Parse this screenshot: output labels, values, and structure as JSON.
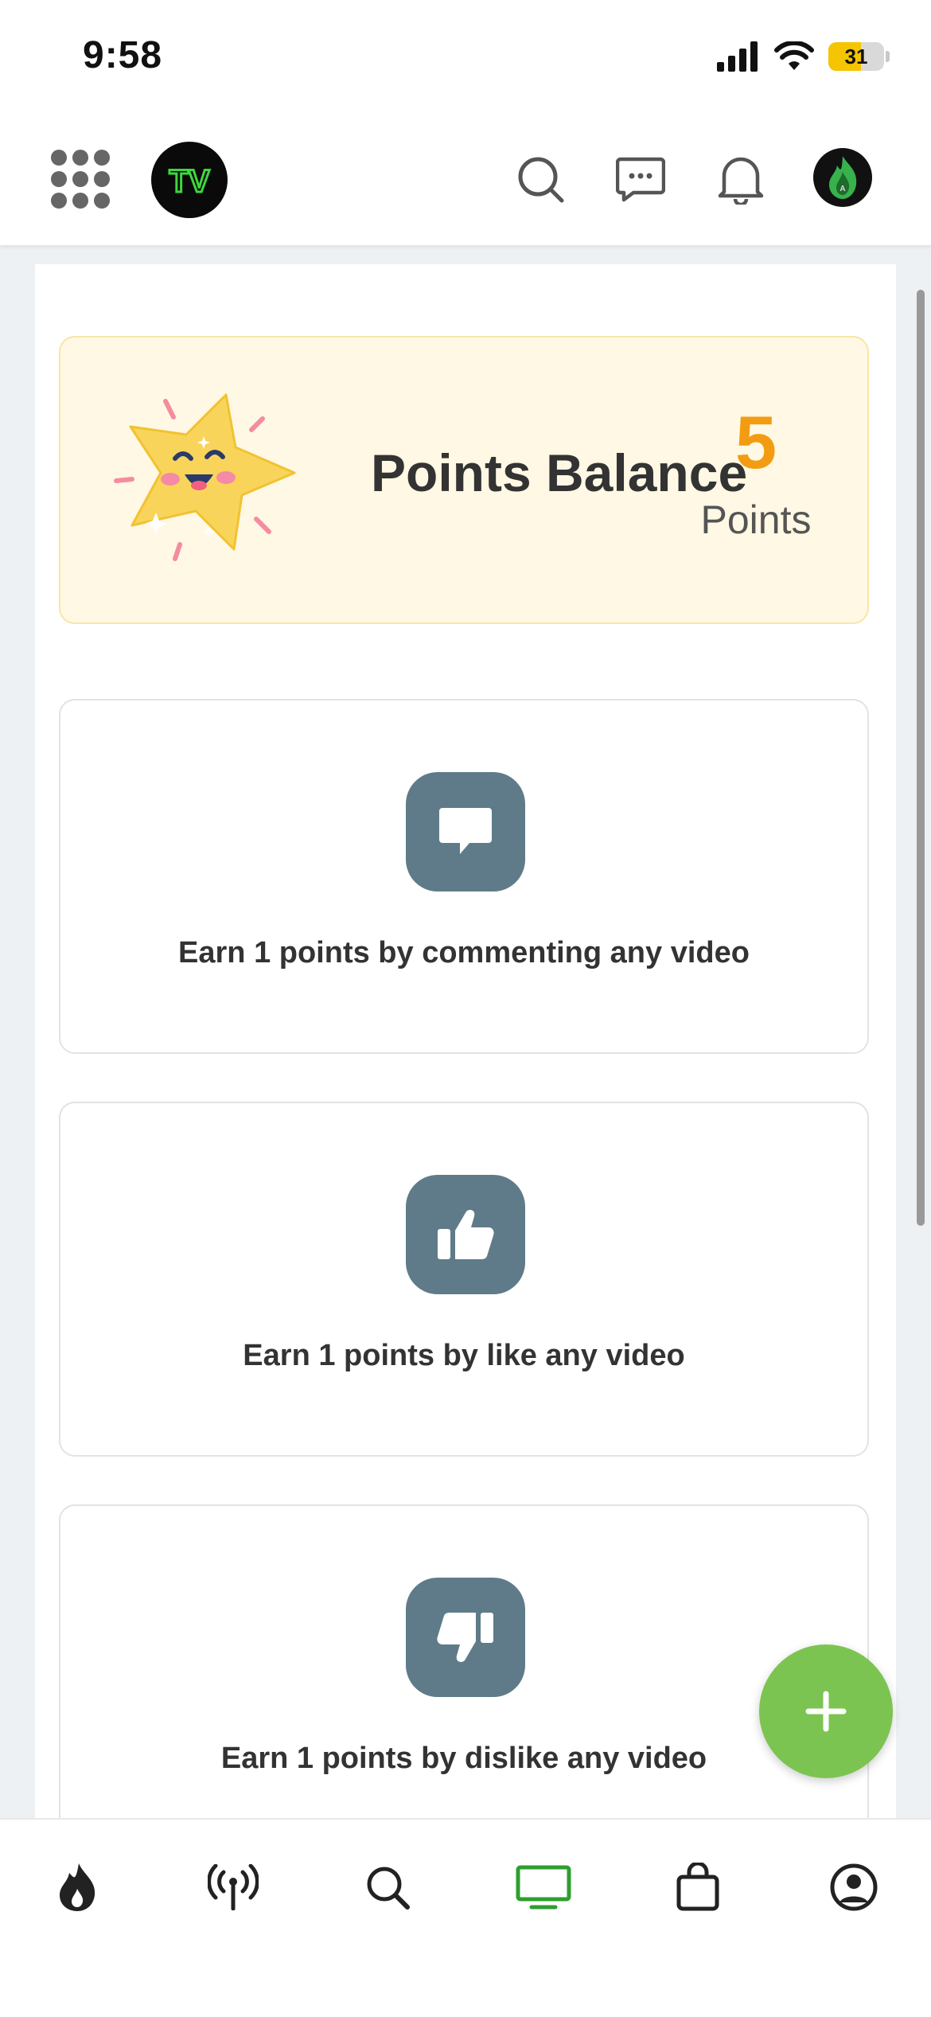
{
  "status_bar": {
    "time": "9:58",
    "battery": "31"
  },
  "header": {
    "logo_text": "TV",
    "icons": [
      "grid-menu-icon",
      "search-icon",
      "chat-icon",
      "bell-icon",
      "avatar"
    ]
  },
  "balance": {
    "title": "Points Balance",
    "value": "5",
    "unit": "Points"
  },
  "earn_cards": [
    {
      "icon": "comment-icon",
      "text": "Earn 1 points by commenting any video"
    },
    {
      "icon": "thumbs-up-icon",
      "text": "Earn 1 points by like any video"
    },
    {
      "icon": "thumbs-down-icon",
      "text": "Earn 1 points by dislike any video"
    }
  ],
  "fab": {
    "label": "+"
  },
  "bottom_nav": {
    "items": [
      "fire-icon",
      "broadcast-icon",
      "search-icon",
      "tv-icon",
      "bag-icon",
      "profile-icon"
    ],
    "active": "tv-icon"
  },
  "colors": {
    "accent_orange": "#f39c12",
    "icon_tile": "#5f7b89",
    "fab_green": "#7cc451",
    "nav_active": "#2f9e2f",
    "balance_bg": "#fff8e4"
  }
}
